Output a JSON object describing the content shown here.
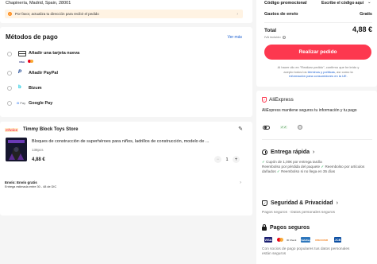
{
  "address": {
    "line": "Chapinería, Madrid, Spain, 28001",
    "warning": "Por favor, actualiza tu dirección para recibir el pedido"
  },
  "payment": {
    "title": "Métodos de pago",
    "see_more": "Ver más",
    "methods": [
      {
        "label": "Añadir una tarjeta nueva",
        "icon": "card-icon"
      },
      {
        "label": "Añadir PayPal",
        "icon": "paypal-icon"
      },
      {
        "label": "Bizum",
        "icon": "bizum-icon"
      },
      {
        "label": "Google Pay",
        "icon": "googlepay-icon"
      }
    ]
  },
  "store": {
    "badge": "Choice",
    "name": "Timmy Block Toys Store",
    "product_title": "Bloques de construcción de superhéroes para niños, ladrillos de construcción, modelo de ...",
    "variant": "138pcs",
    "price": "4,88 €",
    "quantity": "1",
    "shipping_title": "Envío: Envío gratis",
    "shipping_date": "Entrega estimada entre 30 - 48 de DIC"
  },
  "summary": {
    "promo_label": "Código promocional",
    "promo_action": "Escribe el código aquí",
    "shipping_label": "Gastos de envío",
    "shipping_value": "Gratis",
    "total_label": "Total",
    "total_value": "4,88 €",
    "vat_note": "IVA incluido",
    "order_button": "Realizar pedido",
    "legal_1": "Al hacer clic en \"Realizar pedido\", confirmo que he leído y",
    "legal_2": "acepto todos los",
    "legal_link_1": "términos y políticas",
    "legal_3": ", así como la",
    "legal_link_2": "información para consumidores en la UE."
  },
  "trust": {
    "brand": "AliExpress",
    "description": "AliExpress mantiene seguros tu información y tu pago",
    "delivery_title": "Entrega rápida",
    "delivery_items": [
      "Cupón de 1,00€ por entrega tardía",
      "Reembolso por pérdida del paquete",
      "Reembolso por artículos dañados",
      "Reembolso si no llega en 35 días"
    ],
    "security_title": "Seguridad & Privacidad",
    "security_text": "Pagos seguros · Datos personales seguros",
    "payments_title": "Pagos seguros",
    "payments_text": "Con socios de pago populares tus datos personales están seguros"
  },
  "colors": {
    "accent": "#fd384f",
    "link": "#1a5fd0",
    "green": "#07a33c",
    "warning_bg": "#fff3e3"
  }
}
